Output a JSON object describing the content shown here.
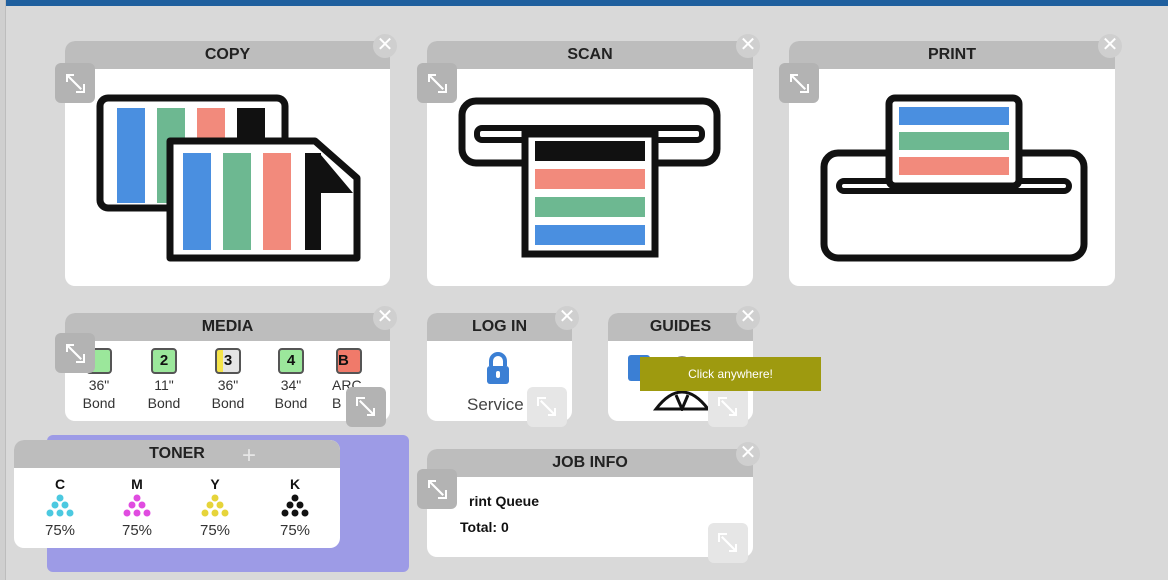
{
  "tiles": {
    "copy": {
      "title": "COPY"
    },
    "scan": {
      "title": "SCAN"
    },
    "print": {
      "title": "PRINT"
    },
    "media": {
      "title": "MEDIA",
      "items": [
        {
          "badge": "",
          "color": "#9bd4a0",
          "size": "36\"",
          "type": "Bond"
        },
        {
          "badge": "2",
          "color": "#9be79b",
          "size": "11\"",
          "type": "Bond"
        },
        {
          "badge": "3",
          "color": "#e5e5e5",
          "size": "36\"",
          "type": "Bond"
        },
        {
          "badge": "4",
          "color": "#9be79b",
          "size": "34\"",
          "type": "Bond"
        },
        {
          "badge": "B",
          "color": "#f07a6a",
          "size": "ARC",
          "type": "B"
        }
      ]
    },
    "login": {
      "title": "LOG IN",
      "label": "Service"
    },
    "guides": {
      "title": "GUIDES"
    },
    "toner": {
      "title": "TONER",
      "add_symbol": "+",
      "items": [
        {
          "letter": "C",
          "percent": "75%",
          "color": "#4cc9e0"
        },
        {
          "letter": "M",
          "percent": "75%",
          "color": "#e04ce0"
        },
        {
          "letter": "Y",
          "percent": "75%",
          "color": "#e6d43a"
        },
        {
          "letter": "K",
          "percent": "75%",
          "color": "#111111"
        }
      ]
    },
    "jobinfo": {
      "title": "JOB INFO",
      "queue_label": "rint Queue",
      "total_label": "Total: 0"
    }
  },
  "tooltip": {
    "text": "Click anywhere!"
  },
  "close_symbol": "✕",
  "colors": {
    "blue": "#4a8fe0",
    "green": "#6db891",
    "salmon": "#f28a7c",
    "black": "#111111",
    "toner_panel_bg": "#9d9be6"
  }
}
